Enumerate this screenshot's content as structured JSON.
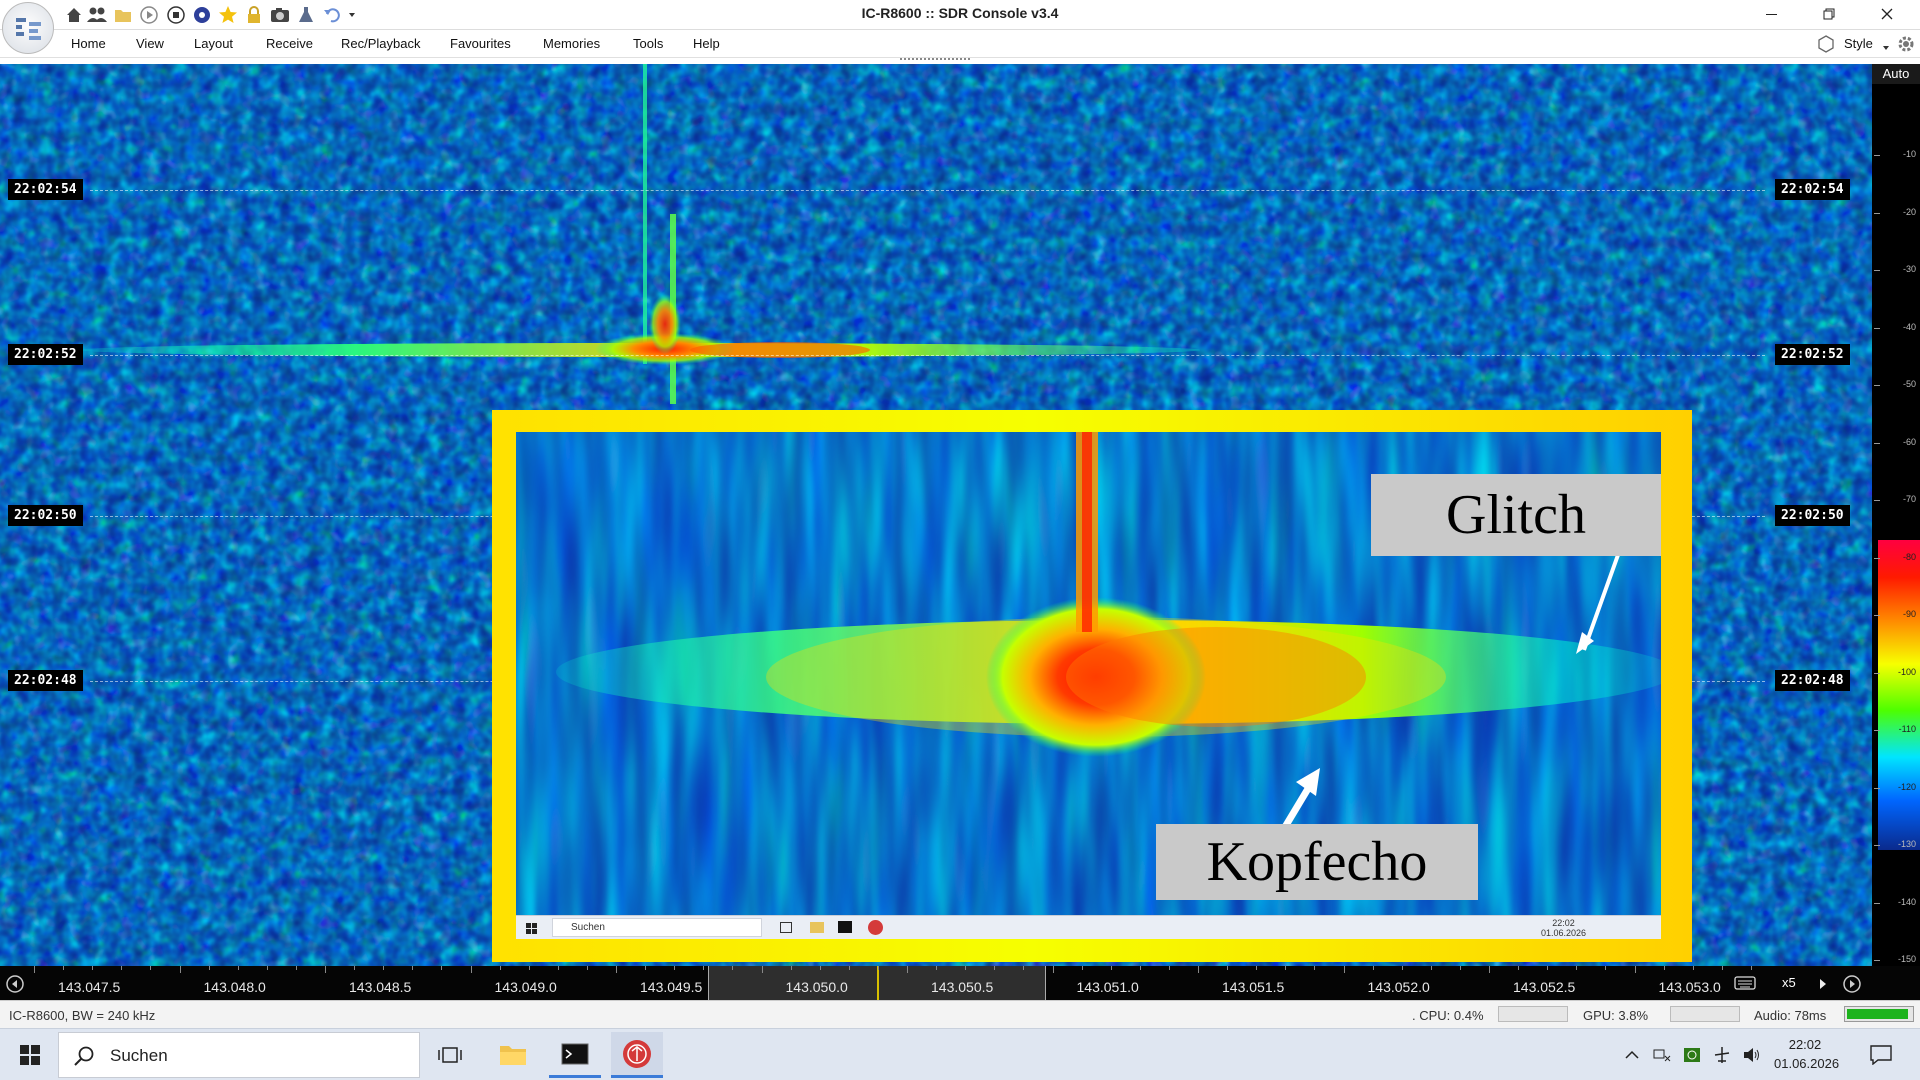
{
  "window": {
    "title": "IC-R8600 :: SDR Console v3.4",
    "minimize_icon": "minimize-icon",
    "restore_icon": "restore-icon",
    "close_icon": "close-icon"
  },
  "quick_access": [
    "home-icon",
    "users-icon",
    "folder-icon",
    "play-icon",
    "stop-icon",
    "radio-icon",
    "star-icon",
    "lock-icon",
    "camera-icon",
    "flask-icon",
    "undo-icon",
    "dropdown-icon"
  ],
  "menu": {
    "items": [
      "Home",
      "View",
      "Layout",
      "Receive",
      "Rec/Playback",
      "Favourites",
      "Memories",
      "Tools",
      "Help"
    ],
    "style_label": "Style"
  },
  "waterfall": {
    "timestamps": [
      "22:02:54",
      "22:02:52",
      "22:02:50",
      "22:02:48"
    ]
  },
  "scale": {
    "mode_label": "Auto",
    "ticks": [
      "-10",
      "-20",
      "-30",
      "-40",
      "-50",
      "-60",
      "-70",
      "-80",
      "-90",
      "-100",
      "-110",
      "-120",
      "-130",
      "-140",
      "-150"
    ]
  },
  "frequency_axis": {
    "ticks": [
      "143.047.5",
      "143.048.0",
      "143.048.5",
      "143.049.0",
      "143.049.5",
      "143.050.0",
      "143.050.5",
      "143.051.0",
      "143.051.5",
      "143.052.0",
      "143.052.5",
      "143.053.0"
    ],
    "zoom_label": "x5"
  },
  "inset": {
    "callout_glitch": "Glitch",
    "callout_kopfecho": "Kopfecho",
    "taskbar_search": "Suchen",
    "taskbar_time": "22:02",
    "taskbar_date": "01.06.2026"
  },
  "status": {
    "device": "IC-R8600, BW = 240 kHz",
    "cpu": ". CPU: 0.4%",
    "gpu": "GPU: 3.8%",
    "audio": "Audio: 78ms",
    "audio_level": 0.95,
    "audio_color": "#1db31d"
  },
  "taskbar": {
    "search_placeholder": "Suchen",
    "time": "22:02",
    "date": "01.06.2026"
  },
  "colors": {
    "waterfall_bg": "#0a2a8c",
    "signal_hot": "#ff1a00",
    "frame_yellow": "#ffe100"
  }
}
